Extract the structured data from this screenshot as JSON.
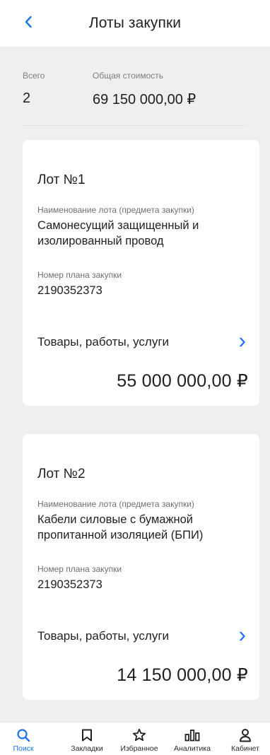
{
  "header": {
    "title": "Лоты закупки"
  },
  "summary": {
    "total_label": "Всего",
    "total_value": "2",
    "cost_label": "Общая стоимость",
    "cost_value": "69 150 000,00 ₽"
  },
  "lots": [
    {
      "title": "Лот №1",
      "name_label": "Наименование лота (предмета закупки)",
      "name_value": "Самонесущий защищенный и изолированный провод",
      "plan_label": "Номер плана закупки",
      "plan_value": "2190352373",
      "goods_label": "Товары, работы, услуги",
      "price": "55 000 000,00 ₽"
    },
    {
      "title": "Лот №2",
      "name_label": "Наименование лота (предмета закупки)",
      "name_value": "Кабели силовые с бумажной пропитанной изоляцией (БПИ)",
      "plan_label": "Номер плана закупки",
      "plan_value": "2190352373",
      "goods_label": "Товары, работы, услуги",
      "price": "14 150 000,00 ₽"
    }
  ],
  "nav": [
    {
      "label": "Поиск",
      "icon": "search-icon",
      "active": true
    },
    {
      "label": "Закладки",
      "icon": "bookmark-icon"
    },
    {
      "label": "Избранное",
      "icon": "star-icon"
    },
    {
      "label": "Аналитика",
      "icon": "analytics-icon"
    },
    {
      "label": "Кабинет",
      "icon": "user-icon"
    }
  ],
  "colors": {
    "accent": "#1a73e8",
    "background": "#efefef",
    "card": "#ffffff"
  }
}
